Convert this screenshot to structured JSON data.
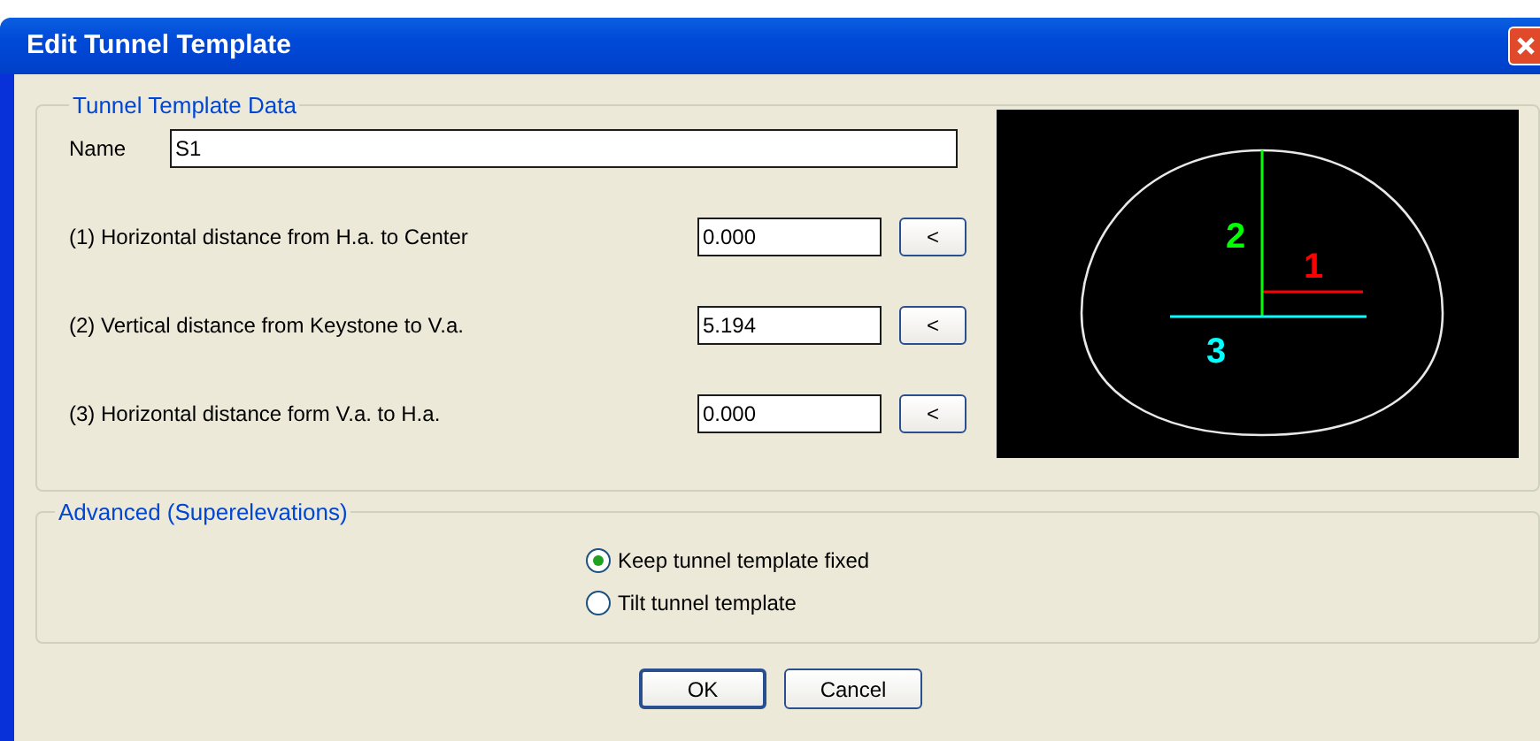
{
  "window": {
    "title": "Edit Tunnel Template"
  },
  "template_group": {
    "title": "Tunnel Template Data",
    "name_label": "Name",
    "name_value": "S1",
    "rows": [
      {
        "label": "(1) Horizontal distance from H.a. to Center",
        "value": "0.000",
        "button": "<"
      },
      {
        "label": "(2) Vertical distance from Keystone to V.a.",
        "value": "5.194",
        "button": "<"
      },
      {
        "label": "(3) Horizontal distance form V.a. to H.a.",
        "value": "0.000",
        "button": "<"
      }
    ],
    "diagram_labels": [
      {
        "text": "1",
        "color": "#ff0000"
      },
      {
        "text": "2",
        "color": "#00ff00"
      },
      {
        "text": "3",
        "color": "#00ffff"
      }
    ]
  },
  "advanced_group": {
    "title": "Advanced (Superelevations)",
    "options": [
      {
        "label": "Keep tunnel template fixed",
        "selected": true
      },
      {
        "label": "Tilt tunnel template",
        "selected": false
      }
    ]
  },
  "buttons": [
    "OK",
    "Cancel"
  ]
}
